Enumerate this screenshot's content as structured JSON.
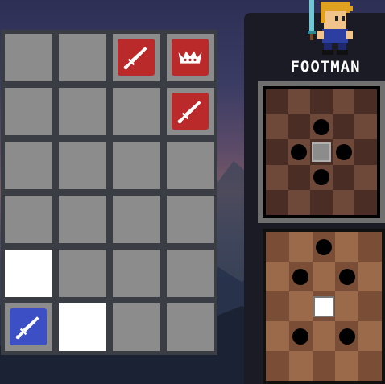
{
  "colors": {
    "cell_empty": "#8c8c8c",
    "cell_highlight": "#ffffff",
    "enemy_piece": "#bb2a2a",
    "player_piece": "#3c4fc4",
    "board_frame": "#3a3d44",
    "panel_bg": "#1a1b24",
    "dark_square_top": "#4a2e26",
    "light_square_top": "#6e4838",
    "dark_square_bottom": "#7a4e36",
    "light_square_bottom": "#9b6a4a"
  },
  "board": {
    "rows": 6,
    "cols": 4,
    "cells": [
      [
        "empty",
        "empty",
        "enemy-sword",
        "enemy-crown"
      ],
      [
        "empty",
        "empty",
        "empty",
        "enemy-sword"
      ],
      [
        "empty",
        "empty",
        "empty",
        "empty"
      ],
      [
        "empty",
        "empty",
        "empty",
        "empty"
      ],
      [
        "highlight",
        "empty",
        "empty",
        "empty"
      ],
      [
        "player-sword",
        "highlight",
        "empty",
        "empty"
      ]
    ]
  },
  "unit": {
    "name": "FOOTMAN",
    "sprite": "footman-sprite"
  },
  "move_patterns": [
    {
      "name": "movement-pattern-selected",
      "center_style": "gray",
      "targets": [
        [
          1,
          2
        ],
        [
          2,
          1
        ],
        [
          2,
          3
        ],
        [
          3,
          2
        ]
      ]
    },
    {
      "name": "movement-pattern-alternate",
      "center_style": "white",
      "targets": [
        [
          0,
          2
        ],
        [
          1,
          1
        ],
        [
          1,
          3
        ],
        [
          3,
          1
        ],
        [
          3,
          3
        ]
      ]
    }
  ]
}
